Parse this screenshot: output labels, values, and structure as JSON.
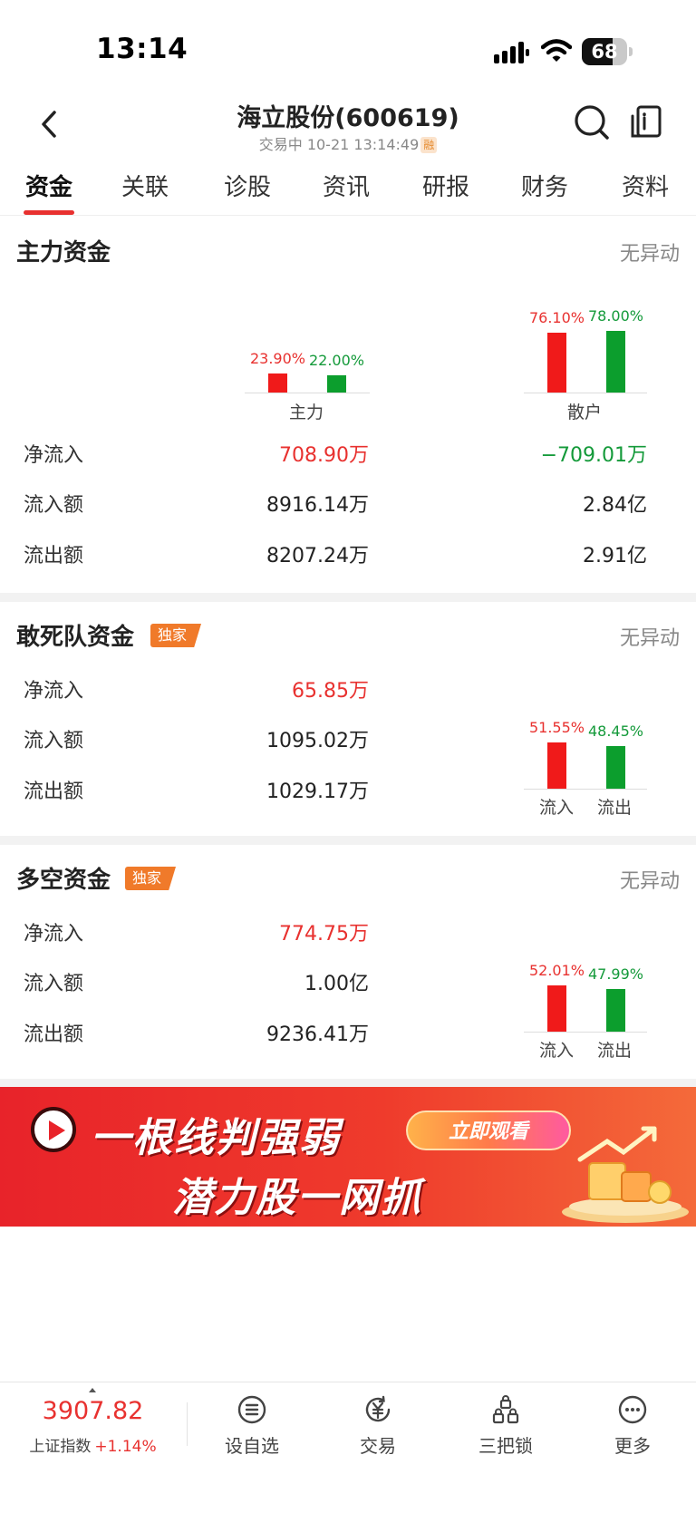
{
  "status_bar": {
    "time": "13:14",
    "battery": "68",
    "battery_level": 0.68
  },
  "header": {
    "title": "海立股份(600619)",
    "subtitle": "交易中 10-21 13:14:49",
    "margin_badge": "融"
  },
  "tabs": [
    "资金",
    "关联",
    "诊股",
    "资讯",
    "研报",
    "财务",
    "资料"
  ],
  "active_tab": 0,
  "main_fund": {
    "title": "主力资金",
    "status": "无异动",
    "chart": {
      "groups": [
        {
          "label": "主力",
          "in_pct": "23.90%",
          "out_pct": "22.00%",
          "in_value": 23.9,
          "out_value": 22.0
        },
        {
          "label": "散户",
          "in_pct": "76.10%",
          "out_pct": "78.00%",
          "in_value": 76.1,
          "out_value": 78.0
        }
      ]
    },
    "rows": [
      {
        "label": "净流入",
        "main": "708.90万",
        "retail": "−709.01万"
      },
      {
        "label": "流入额",
        "main": "8916.14万",
        "retail": "2.84亿"
      },
      {
        "label": "流出额",
        "main": "8207.24万",
        "retail": "2.91亿"
      }
    ]
  },
  "dare_fund": {
    "title": "敢死队资金",
    "badge": "独家",
    "status": "无异动",
    "rows": [
      {
        "label": "净流入",
        "value": "65.85万"
      },
      {
        "label": "流入额",
        "value": "1095.02万"
      },
      {
        "label": "流出额",
        "value": "1029.17万"
      }
    ],
    "chart": {
      "in_pct": "51.55%",
      "out_pct": "48.45%",
      "in_value": 51.55,
      "out_value": 48.45,
      "in_label": "流入",
      "out_label": "流出"
    }
  },
  "long_short_fund": {
    "title": "多空资金",
    "badge": "独家",
    "status": "无异动",
    "rows": [
      {
        "label": "净流入",
        "value": "774.75万"
      },
      {
        "label": "流入额",
        "value": "1.00亿"
      },
      {
        "label": "流出额",
        "value": "9236.41万"
      }
    ],
    "chart": {
      "in_pct": "52.01%",
      "out_pct": "47.99%",
      "in_value": 52.01,
      "out_value": 47.99,
      "in_label": "流入",
      "out_label": "流出"
    }
  },
  "banner": {
    "line1": "一根线判强弱",
    "line2": "潜力股一网抓",
    "cta": "立即观看"
  },
  "bottom_bar": {
    "index_value": "3907.82",
    "index_name": "上证指数",
    "index_change": "+1.14%",
    "nav": [
      {
        "label": "设自选",
        "icon": "list-icon"
      },
      {
        "label": "交易",
        "icon": "yuan-exchange-icon"
      },
      {
        "label": "三把锁",
        "icon": "locks-icon"
      },
      {
        "label": "更多",
        "icon": "more-dots-icon"
      }
    ]
  },
  "colors": {
    "up": "#e8312f",
    "down": "#149a3a",
    "bar_up": "#f01a1a",
    "bar_down": "#0c9e2d",
    "badge": "#f07a2a"
  }
}
